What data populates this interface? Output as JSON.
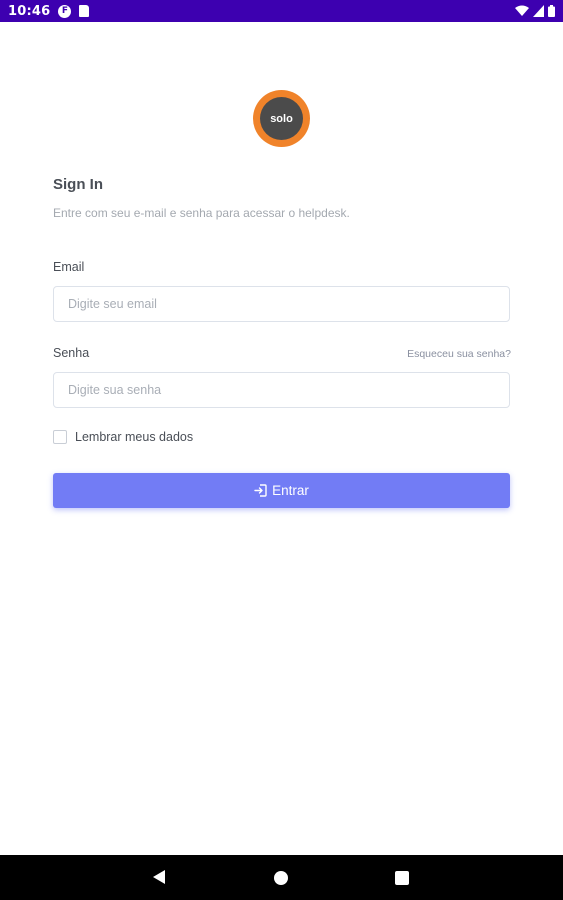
{
  "status_bar": {
    "time": "10:46",
    "notification_icons": [
      "f-app-icon",
      "sd-card-icon"
    ],
    "system_icons": [
      "wifi-icon",
      "cell-signal-icon",
      "battery-icon"
    ],
    "background_color": "#3d00b0"
  },
  "logo": {
    "text": "solo",
    "outer_color": "#f0832a",
    "inner_color": "#4b4b4b"
  },
  "header": {
    "title": "Sign In",
    "subtitle": "Entre com seu e-mail e senha para acessar o helpdesk."
  },
  "form": {
    "email": {
      "label": "Email",
      "placeholder": "Digite seu email",
      "value": ""
    },
    "password": {
      "label": "Senha",
      "placeholder": "Digite sua senha",
      "value": "",
      "forgot_link": "Esqueceu sua senha?"
    },
    "remember": {
      "label": "Lembrar meus dados",
      "checked": false
    },
    "submit": {
      "label": "Entrar",
      "icon": "login-icon",
      "color": "#727cf5"
    }
  },
  "nav_bar": {
    "buttons": [
      "back-icon",
      "home-icon",
      "recents-icon"
    ]
  }
}
